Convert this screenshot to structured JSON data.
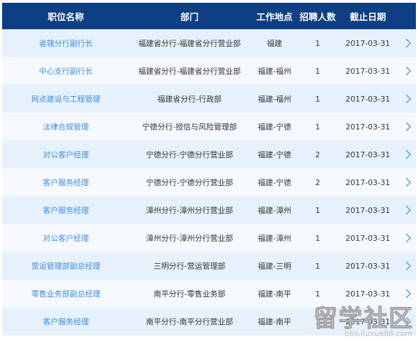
{
  "columns": {
    "title": "职位名称",
    "department": "部门",
    "location": "工作地点",
    "count": "招聘人数",
    "deadline": "截止日期"
  },
  "rows": [
    {
      "title": "省辖分行副行长",
      "department": "福建省分行-福建省分行营业部",
      "location": "福建",
      "count": "1",
      "deadline": "2017-03-31"
    },
    {
      "title": "中心支行副行长",
      "department": "福建省分行-福建省分行营业部",
      "location": "福建-福州",
      "count": "1",
      "deadline": "2017-03-31"
    },
    {
      "title": "网点建设与工程管理",
      "department": "福建省分行-行政部",
      "location": "福建-福州",
      "count": "1",
      "deadline": "2017-03-31"
    },
    {
      "title": "法律合规管理",
      "department": "宁德分行-授信与风险管理部",
      "location": "福建-宁德",
      "count": "1",
      "deadline": "2017-03-31"
    },
    {
      "title": "对公客户经理",
      "department": "宁德分行-宁德分行营业部",
      "location": "福建-宁德",
      "count": "2",
      "deadline": "2017-03-31"
    },
    {
      "title": "客户服务经理",
      "department": "宁德分行-宁德分行营业部",
      "location": "福建-宁德",
      "count": "2",
      "deadline": "2017-03-31"
    },
    {
      "title": "客户服务经理",
      "department": "漳州分行-漳州分行营业部",
      "location": "福建-漳州",
      "count": "1",
      "deadline": "2017-03-31"
    },
    {
      "title": "对公客户经理",
      "department": "漳州分行-漳州分行营业部",
      "location": "福建-漳州",
      "count": "1",
      "deadline": "2017-03-31"
    },
    {
      "title": "营运管理部副总经理",
      "department": "三明分行-营运管理部",
      "location": "福建-三明",
      "count": "1",
      "deadline": "2017-03-31"
    },
    {
      "title": "零售业务部副总经理",
      "department": "南平分行-零售业务部",
      "location": "福建-南平",
      "count": "1",
      "deadline": "2017-03-31"
    },
    {
      "title": "客户服务经理",
      "department": "南平分行-南平分行营业部",
      "location": "福建-南平",
      "count": "1",
      "deadline": "2017-03-31"
    }
  ],
  "icons": {
    "row_action": "chevron-right-icon"
  },
  "colors": {
    "header_bg": "#0e3f84",
    "row_odd": "#e6f1fb",
    "row_even": "#f5f9fd",
    "link": "#3f8ed6",
    "chevron": "#5b9bd5"
  },
  "watermark": {
    "logo": "留学社区",
    "url": "bbs.liuxue86.com"
  }
}
